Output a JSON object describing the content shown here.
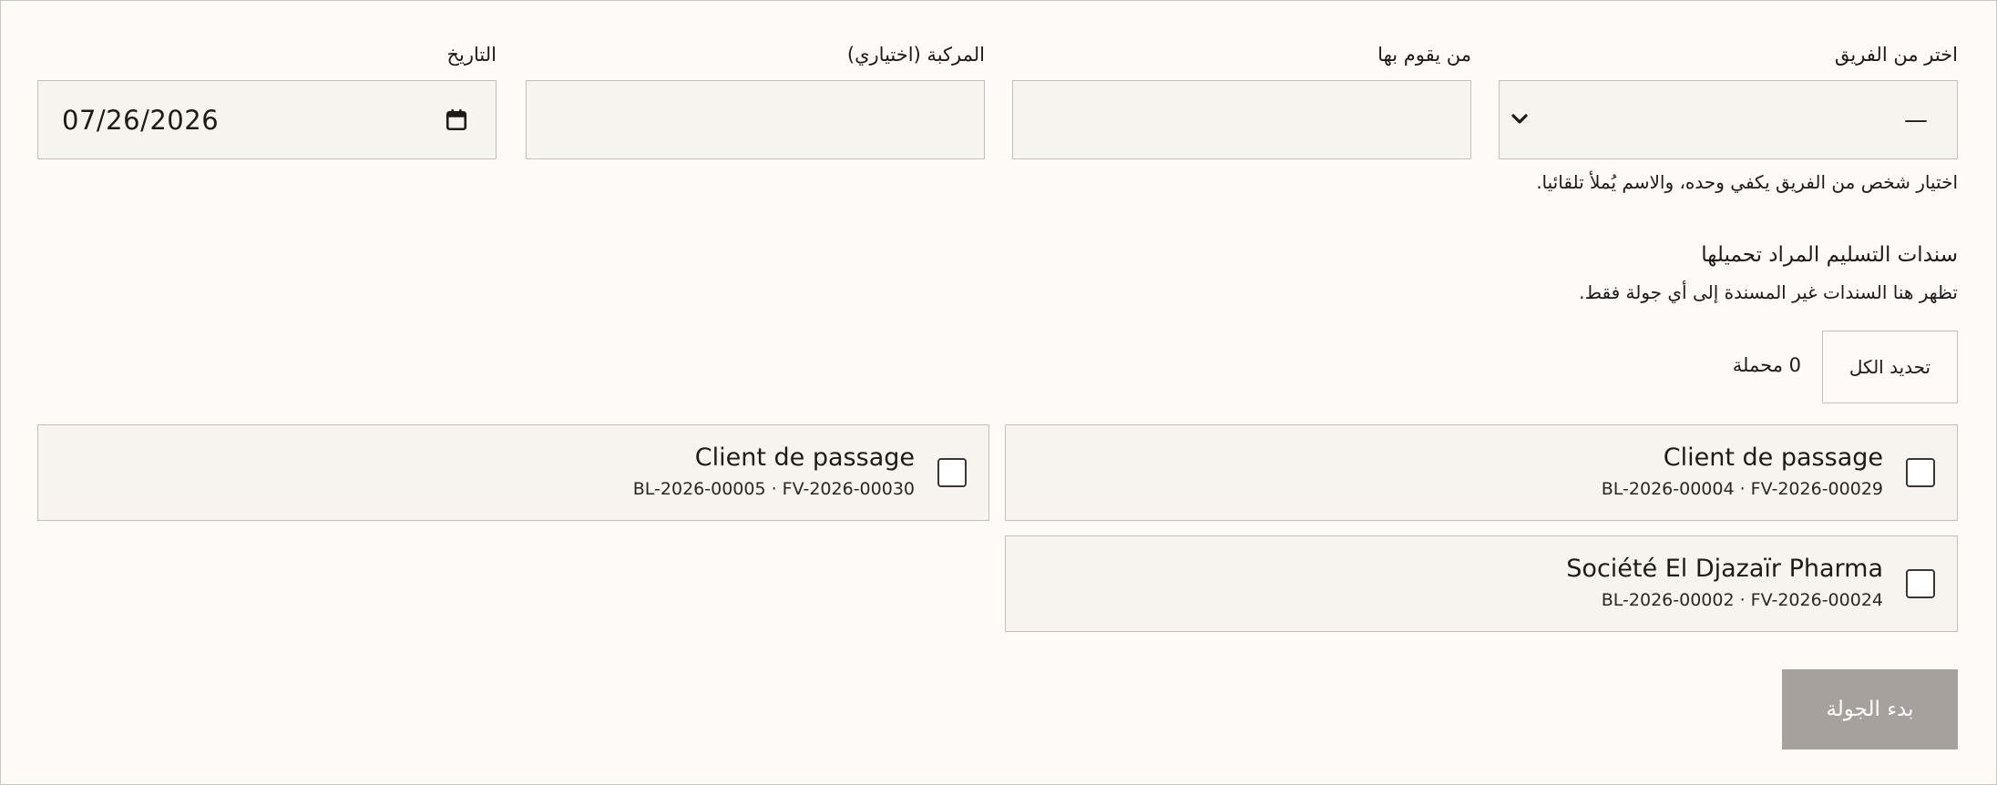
{
  "form": {
    "team_label": "اختر من الفريق",
    "team_value": "—",
    "who_label": "من يقوم بها",
    "who_value": "",
    "vehicle_label": "المركبة (اختياري)",
    "vehicle_value": "",
    "date_label": "التاريخ",
    "date_value": "07/26/2026",
    "team_hint": "اختيار شخص من الفريق يكفي وحده، والاسم يُملأ تلقائيا."
  },
  "notes_section": {
    "title": "سندات التسليم المراد تحميلها",
    "subtitle": "تظهر هنا السندات غير المسندة إلى أي جولة فقط.",
    "select_all_label": "تحديد الكل",
    "loaded_count": "0 محملة"
  },
  "notes": [
    {
      "client": "Client de passage",
      "refs": "BL-2026-00004 · FV-2026-00029",
      "checked": false
    },
    {
      "client": "Client de passage",
      "refs": "BL-2026-00005 · FV-2026-00030",
      "checked": false
    },
    {
      "client": "Société El Djazaïr Pharma",
      "refs": "BL-2026-00002 · FV-2026-00024",
      "checked": false
    }
  ],
  "actions": {
    "start_label": "بدء الجولة"
  },
  "icons": {
    "select": "chevron-down-icon",
    "date": "calendar-icon"
  },
  "colors": {
    "background": "#fdfaf8",
    "field_background": "#f7f3ee",
    "border": "#c8bfb8",
    "button_disabled": "#a7a19d"
  }
}
